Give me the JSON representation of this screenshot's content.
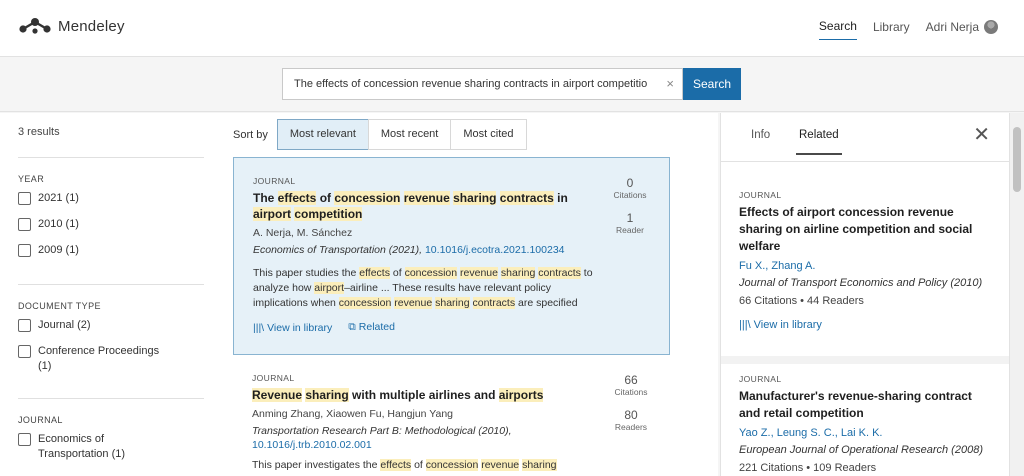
{
  "header": {
    "brand": "Mendeley",
    "nav": {
      "search": "Search",
      "library": "Library",
      "user": "Adri Nerja"
    }
  },
  "search": {
    "value": "The effects of concession revenue sharing contracts in airport competitio",
    "clear": "×",
    "button": "Search"
  },
  "filters": {
    "results_count": "3 results",
    "year": {
      "heading": "YEAR",
      "options": [
        "2021 (1)",
        "2010 (1)",
        "2009 (1)"
      ]
    },
    "doctype": {
      "heading": "DOCUMENT TYPE",
      "options": [
        "Journal (2)",
        "Conference Proceedings (1)"
      ]
    },
    "journal": {
      "heading": "JOURNAL",
      "options": [
        "Economics of Transportation (1)"
      ]
    }
  },
  "sort": {
    "label": "Sort by",
    "options": [
      "Most relevant",
      "Most recent",
      "Most cited"
    ],
    "selected": "Most relevant"
  },
  "results": [
    {
      "type": "JOURNAL",
      "title_parts": [
        {
          "t": "The ",
          "h": false
        },
        {
          "t": "effects",
          "h": true
        },
        {
          "t": " of ",
          "h": false
        },
        {
          "t": "concession",
          "h": true
        },
        {
          "t": " ",
          "h": false
        },
        {
          "t": "revenue",
          "h": true
        },
        {
          "t": " ",
          "h": false
        },
        {
          "t": "sharing",
          "h": true
        },
        {
          "t": " ",
          "h": false
        },
        {
          "t": "contracts",
          "h": true
        },
        {
          "t": " in ",
          "h": false
        },
        {
          "t": "airport",
          "h": true
        },
        {
          "t": " ",
          "h": false
        },
        {
          "t": "competition",
          "h": true
        }
      ],
      "authors": "A. Nerja, M. Sánchez",
      "journal": "Economics of Transportation (2021), ",
      "doi": "10.1016/j.ecotra.2021.100234",
      "abstract_parts": [
        {
          "t": "This paper studies the ",
          "h": false
        },
        {
          "t": "effects",
          "h": true
        },
        {
          "t": " of ",
          "h": false
        },
        {
          "t": "concession",
          "h": true
        },
        {
          "t": " ",
          "h": false
        },
        {
          "t": "revenue",
          "h": true
        },
        {
          "t": " ",
          "h": false
        },
        {
          "t": "sharing",
          "h": true
        },
        {
          "t": " ",
          "h": false
        },
        {
          "t": "contracts",
          "h": true
        },
        {
          "t": " to analyze how ",
          "h": false
        },
        {
          "t": "airport",
          "h": true
        },
        {
          "t": "–airline ... These results have relevant policy implications when ",
          "h": false
        },
        {
          "t": "concession",
          "h": true
        },
        {
          "t": " ",
          "h": false
        },
        {
          "t": "revenue",
          "h": true
        },
        {
          "t": " ",
          "h": false
        },
        {
          "t": "sharing",
          "h": true
        },
        {
          "t": " ",
          "h": false
        },
        {
          "t": "contracts",
          "h": true
        },
        {
          "t": " are specified",
          "h": false
        }
      ],
      "citations": "0",
      "citations_label": "Citations",
      "readers": "1",
      "readers_label": "Reader",
      "view_in_library": "View in library",
      "related": "Related"
    },
    {
      "type": "JOURNAL",
      "title_parts": [
        {
          "t": "Revenue",
          "h": true
        },
        {
          "t": " ",
          "h": false
        },
        {
          "t": "sharing",
          "h": true
        },
        {
          "t": " with multiple airlines and ",
          "h": false
        },
        {
          "t": "airports",
          "h": true
        }
      ],
      "authors": "Anming Zhang, Xiaowen Fu, Hangjun Yang",
      "journal": "Transportation Research Part B: Methodological (2010), ",
      "doi": "10.1016/j.trb.2010.02.001",
      "abstract_parts": [
        {
          "t": "This paper investigates the ",
          "h": false
        },
        {
          "t": "effects",
          "h": true
        },
        {
          "t": " of ",
          "h": false
        },
        {
          "t": "concession",
          "h": true
        },
        {
          "t": " ",
          "h": false
        },
        {
          "t": "revenue",
          "h": true
        },
        {
          "t": " ",
          "h": false
        },
        {
          "t": "sharing",
          "h": true
        }
      ],
      "citations": "66",
      "citations_label": "Citations",
      "readers": "80",
      "readers_label": "Readers"
    }
  ],
  "panel": {
    "tabs": [
      "Info",
      "Related"
    ],
    "active_tab": "Related",
    "close": "✕",
    "related": [
      {
        "type": "JOURNAL",
        "title": "Effects of airport concession revenue sharing on airline competition and social welfare",
        "authors": "Fu X., Zhang A.",
        "journal": "Journal of Transport Economics and Policy (2010)",
        "meta": "66 Citations • 44 Readers",
        "view": "View in library"
      },
      {
        "type": "JOURNAL",
        "title": "Manufacturer's revenue-sharing contract and retail competition",
        "authors": "Yao Z., Leung S. C., Lai K. K.",
        "journal": "European Journal of Operational Research (2008)",
        "meta": "221 Citations • 109 Readers"
      }
    ]
  },
  "colors": {
    "accent": "#1b6ca8",
    "highlight": "#fbeebb",
    "selected_bg": "#e6f1f8"
  }
}
